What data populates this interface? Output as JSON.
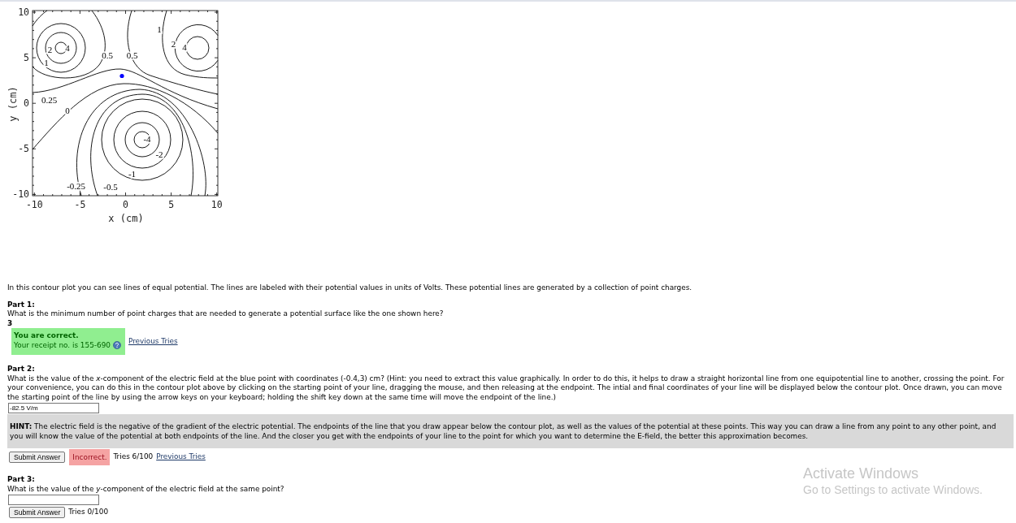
{
  "contour_plot": {
    "xlabel": "x (cm)",
    "ylabel": "y (cm)",
    "xticks": [
      "-10",
      "-5",
      "0",
      "5",
      "10"
    ],
    "yticks": [
      "10",
      "5",
      "0",
      "-5",
      "-10"
    ],
    "contour_labels": [
      "2",
      "4",
      "1",
      "0.5",
      "0.5",
      "1",
      "2",
      "4",
      "0.25",
      "0",
      "-4",
      "-2",
      "-1",
      "-0.25",
      "-0.5"
    ]
  },
  "intro": "In this contour plot you can see lines of equal potential. The lines are labeled with their potential values in units of Volts. These potential lines are generated by a collection of point charges.",
  "parts": [
    {
      "kind": "answered",
      "title": "Part 1:",
      "question": "What is the minimum number of point charges that are needed to generate a potential surface like the one shown here?",
      "answer": "3",
      "feedback": {
        "correct": true,
        "title": "You are correct.",
        "text": "Your receipt no. is 155-690"
      },
      "link": "Previous Tries"
    },
    {
      "kind": "input",
      "title": "Part 2:",
      "question": "What is the value of the *x*-component of the electric field at the blue point with coordinates (-0.4,3) cm? (Hint: you need to extract this value graphically. In order to do this, it helps to draw a straight horizontal line from one equipotential line to another, crossing the point. For your convenience, you can do this in the contour plot above by clicking on the starting point of your line, dragging the mouse, and then releasing at the endpoint. The intial and final coordinates of your line will be displayed below the contour plot. Once drawn, you can move the starting point of the line by using the arrow keys on your keyboard; holding the shift key down at the same time will move the endpoint of the line.)",
      "value": "-82.5 V/m",
      "hint": "**HINT:** The electric field is the negative of the gradient of the electric potential. The endpoints of the line that you draw appear below the contour plot, as well as the values of the potential at these points. This way you can draw a line from any point to any other point, and you will know the value of the potential at both endpoints of the line. And the closer you get with the endpoints of your line to the point for which you want to determine the E-field, the better this approximation becomes.",
      "submit": "Submit Answer",
      "feedback": {
        "correct": false,
        "text": "Incorrect."
      },
      "tries": "Tries 6/100",
      "link": "Previous Tries"
    },
    {
      "kind": "input",
      "title": "Part 3:",
      "question": "What is the value of the *y*-component of the electric field at the same point?",
      "submit": "Submit Answer",
      "tries": "Tries 0/100"
    }
  ],
  "os_notice": {
    "title": "Activate Windows",
    "text": "Go to Settings to activate Windows."
  }
}
